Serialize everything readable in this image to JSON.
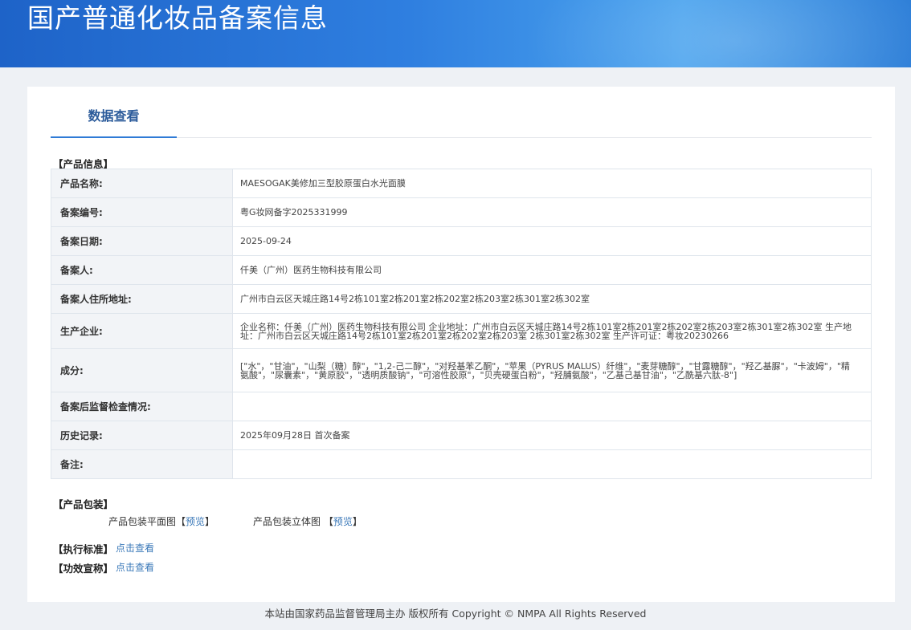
{
  "header": {
    "title": "国产普通化妆品备案信息"
  },
  "tabs": [
    {
      "label": "数据查看"
    }
  ],
  "sections": {
    "product_info": "【产品信息】",
    "packaging": "【产品包装】",
    "standard": "【执行标准】",
    "efficacy": "【功效宣称】"
  },
  "rows": [
    {
      "key": "产品名称:",
      "value": "MAESOGAK美修加三型胶原蛋白水光面膜"
    },
    {
      "key": "备案编号:",
      "value": "粤G妆网备字2025331999"
    },
    {
      "key": "备案日期:",
      "value": "2025-09-24"
    },
    {
      "key": "备案人:",
      "value": "仟美（广州）医药生物科技有限公司"
    },
    {
      "key": "备案人住所地址:",
      "value": "广州市白云区天城庄路14号2栋101室2栋201室2栋202室2栋203室2栋301室2栋302室"
    },
    {
      "key": "生产企业:",
      "value": "企业名称：仟美（广州）医药生物科技有限公司 企业地址：广州市白云区天城庄路14号2栋101室2栋201室2栋202室2栋203室2栋301室2栋302室 生产地址：广州市白云区天城庄路14号2栋101室2栋201室2栋202室2栋203室 2栋301室2栋302室 生产许可证：粤妆20230266"
    },
    {
      "key": "成分:",
      "value": "[\"水\"，\"甘油\"，\"山梨（糖）醇\"，\"1,2-己二醇\"，\"对羟基苯乙酮\"，\"苹果（PYRUS MALUS）纤维\"，\"麦芽糖醇\"，\"甘露糖醇\"，\"羟乙基脲\"，\"卡波姆\"，\"精氨酸\"，\"尿囊素\"，\"黄原胶\"，\"透明质酸钠\"，\"可溶性胶原\"，\"贝壳硬蛋白粉\"，\"羟脯氨酸\"，\"乙基己基甘油\"，\"乙酰基六肽-8\"]"
    },
    {
      "key": "备案后监督检查情况:",
      "value": ""
    },
    {
      "key": "历史记录:",
      "value": "2025年09月28日 首次备案"
    },
    {
      "key": "备注:",
      "value": ""
    }
  ],
  "packaging": {
    "flat_label": "产品包装平面图",
    "flat_link": "预览",
    "solid_label": "产品包装立体图",
    "solid_link": "预览",
    "bracket_open": "【",
    "bracket_close": "】"
  },
  "links": {
    "standard": "点击查看",
    "efficacy": "点击查看"
  },
  "footer": {
    "text": "本站由国家药品监督管理局主办 版权所有 Copyright © NMPA All Rights Reserved"
  }
}
